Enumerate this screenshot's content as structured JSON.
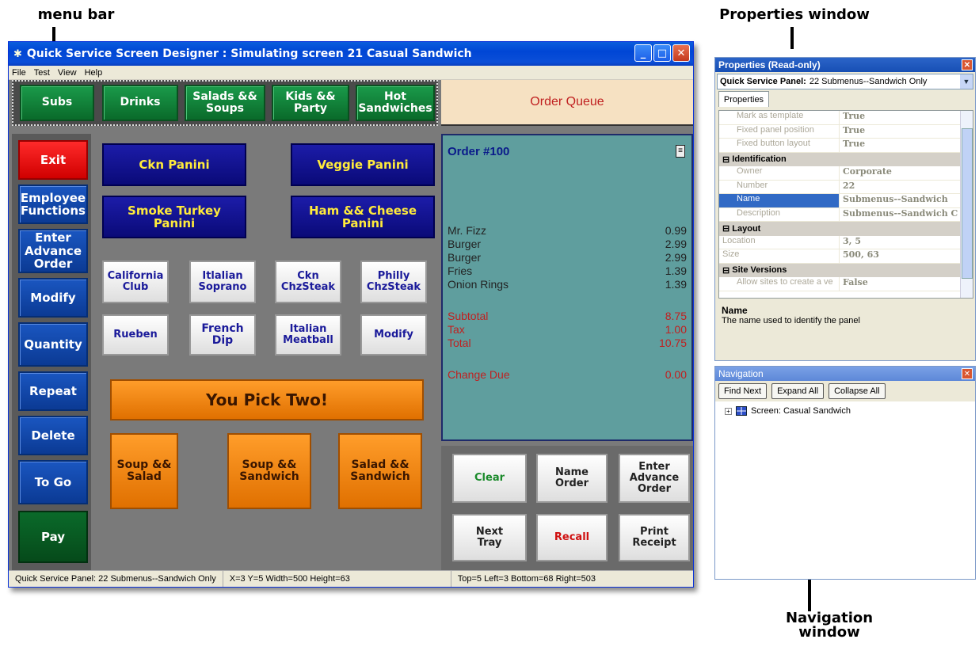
{
  "callouts": {
    "menu_bar": "menu bar",
    "properties_window": "Properties window",
    "navigation_window": "Navigation window"
  },
  "window": {
    "title": "Quick Service Screen Designer : Simulating screen 21 Casual Sandwich",
    "menu": [
      "File",
      "Test",
      "View",
      "Help"
    ]
  },
  "top_tabs": [
    "Subs",
    "Drinks",
    "Salads &&\nSoups",
    "Kids &&\nParty",
    "Hot\nSandwiches"
  ],
  "order_queue": "Order Queue",
  "left_buttons": [
    "Exit",
    "Employee\nFunctions",
    "Enter\nAdvance\nOrder",
    "Modify",
    "Quantity",
    "Repeat",
    "Delete",
    "To Go",
    "Pay"
  ],
  "panini": [
    "Ckn Panini",
    "Veggie Panini",
    "Smoke Turkey\nPanini",
    "Ham && Cheese\nPanini"
  ],
  "sandwiches": [
    "California\nClub",
    "Itlalian\nSoprano",
    "Ckn\nChzSteak",
    "Philly\nChzSteak",
    "Rueben",
    "French\nDip",
    "Italian\nMeatball",
    "Modify"
  ],
  "banner": "You Pick Two!",
  "combos": [
    "Soup &&\nSalad",
    "Soup &&\nSandwich",
    "Salad &&\nSandwich"
  ],
  "order": {
    "header": "Order #100",
    "items": [
      {
        "name": "Mr. Fizz",
        "price": "0.99"
      },
      {
        "name": "Burger",
        "price": "2.99"
      },
      {
        "name": "Burger",
        "price": "2.99"
      },
      {
        "name": "Fries",
        "price": "1.39"
      },
      {
        "name": "Onion Rings",
        "price": "1.39"
      }
    ],
    "subtotal_label": "Subtotal",
    "subtotal": "8.75",
    "tax_label": "Tax",
    "tax": "1.00",
    "total_label": "Total",
    "total": "10.75",
    "change_label": "Change Due",
    "change": "0.00"
  },
  "order_actions": [
    "Clear",
    "Name\nOrder",
    "Enter\nAdvance\nOrder",
    "Next\nTray",
    "Recall",
    "Print\nReceipt"
  ],
  "status": {
    "panel": "Quick Service Panel: 22 Submenus--Sandwich Only",
    "coords": "X=3 Y=5 Width=500 Height=63",
    "bounds": "Top=5 Left=3 Bottom=68 Right=503"
  },
  "properties": {
    "title": "Properties (Read-only)",
    "combo_bold": "Quick Service Panel:",
    "combo_value": "22 Submenus--Sandwich Only",
    "tab": "Properties",
    "rows_top": [
      {
        "label": "Mark as template",
        "value": "True"
      },
      {
        "label": "Fixed panel position",
        "value": "True"
      },
      {
        "label": "Fixed button layout",
        "value": "True"
      }
    ],
    "cat_identification": "Identification",
    "rows_ident": [
      {
        "label": "Owner",
        "value": "Corporate"
      },
      {
        "label": "Number",
        "value": "22"
      },
      {
        "label": "Name",
        "value": "Submenus--Sandwich"
      },
      {
        "label": "Description",
        "value": "Submenus--Sandwich C"
      }
    ],
    "cat_layout": "Layout",
    "rows_layout": [
      {
        "label": "Location",
        "value": "3, 5"
      },
      {
        "label": "Size",
        "value": "500, 63"
      }
    ],
    "cat_site": "Site Versions",
    "rows_site": [
      {
        "label": "Allow sites to create a ve",
        "value": "False"
      }
    ],
    "desc_title": "Name",
    "desc_text": "The name used to identify the panel"
  },
  "navigation": {
    "title": "Navigation",
    "buttons": [
      "Find Next",
      "Expand All",
      "Collapse All"
    ],
    "tree_item": "Screen: Casual Sandwich"
  },
  "colors": {
    "accent": "#0046d5",
    "order_bg": "#5f9e9e",
    "queue_bg": "#f6e1c2"
  }
}
